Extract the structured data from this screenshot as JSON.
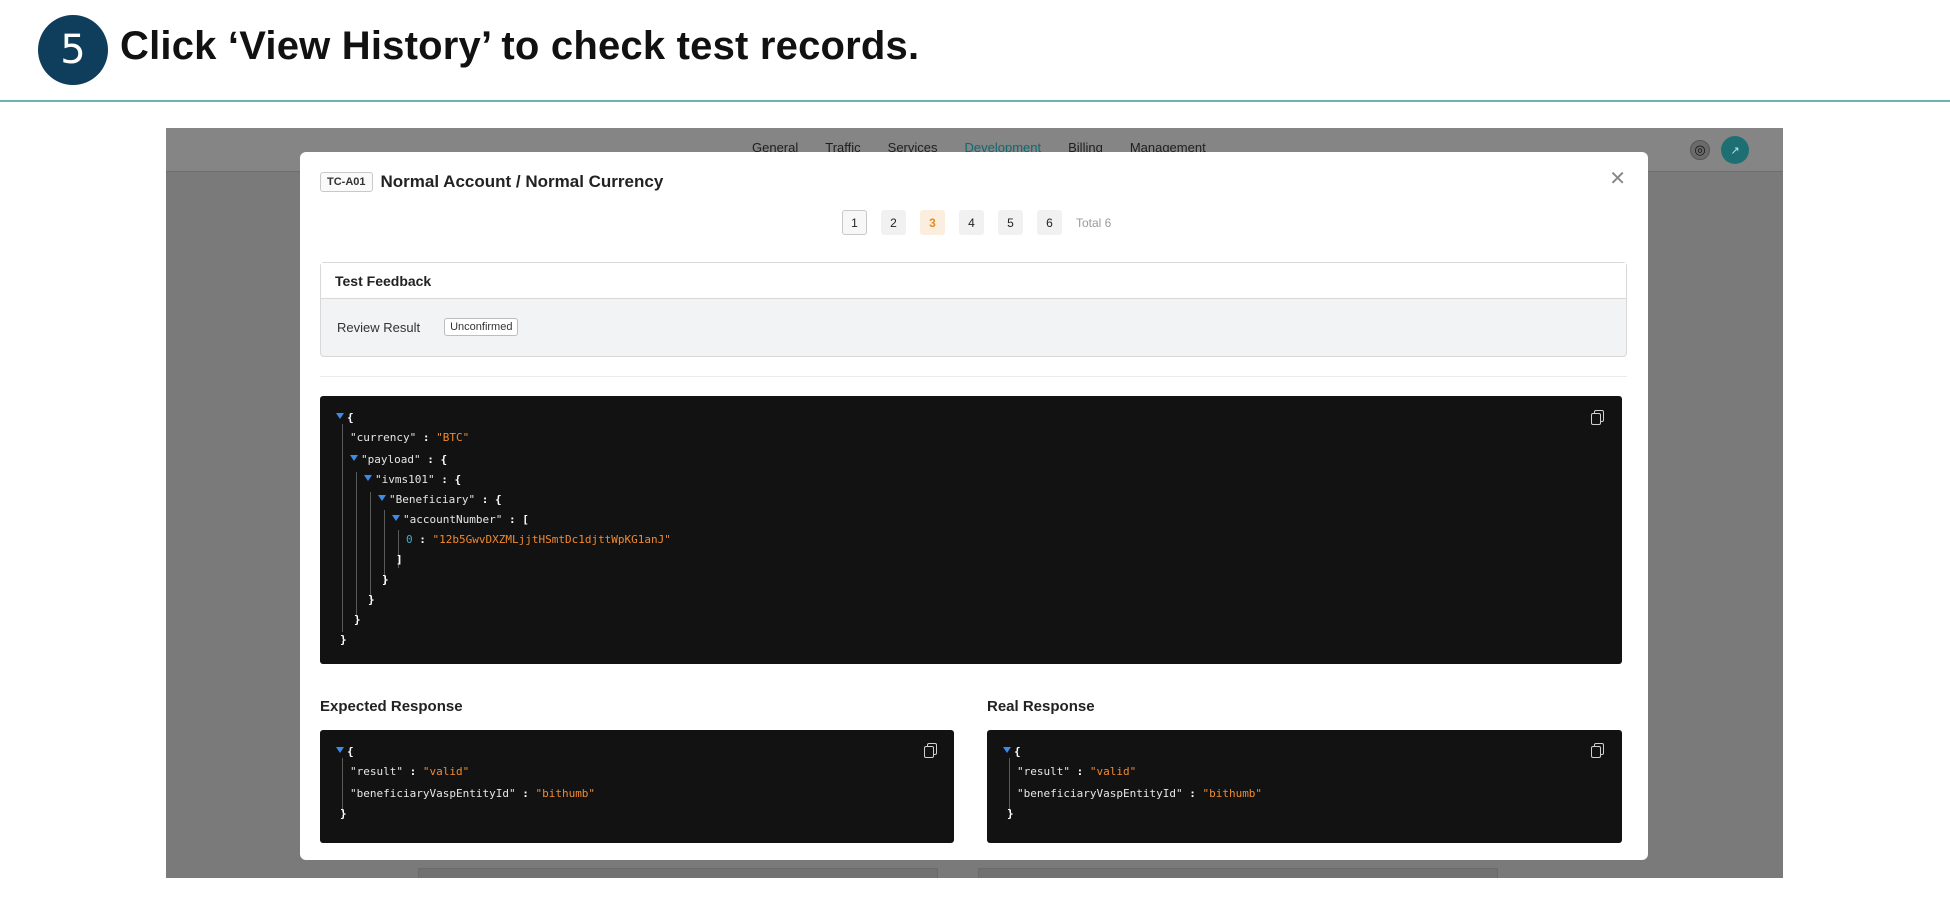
{
  "step": {
    "number": "5",
    "title": "Click ‘View History’ to check test records."
  },
  "topbar": {
    "nav": [
      "General",
      "Traffic",
      "Services",
      "Development",
      "Billing",
      "Management"
    ],
    "active_index": 3,
    "globe_icon": "globe-icon",
    "avatar_text": "↗"
  },
  "modal": {
    "tag": "TC-A01",
    "title": "Normal Account / Normal Currency",
    "close_glyph": "✕",
    "pagination": {
      "pages": [
        "1",
        "2",
        "3",
        "4",
        "5",
        "6"
      ],
      "current": "3",
      "total": "Total 6"
    },
    "feedback": {
      "header": "Test Feedback",
      "label": "Review Result",
      "value": "Unconfirmed"
    },
    "request": {
      "open": "{",
      "currency_key": "\"currency\"",
      "currency_val": "\"BTC\"",
      "payload_key": "\"payload\"",
      "ivms_key": "\"ivms101\"",
      "beneficiary_key": "\"Beneficiary\"",
      "account_key": "\"accountNumber\"",
      "bracket_open": "[",
      "index": "0",
      "account_val": "\"12b5GwvDXZMLjjtHSmtDc1djttWpKG1anJ\"",
      "bracket_close": "]",
      "close": "}",
      "colon": " : "
    },
    "expected": {
      "label": "Expected Response",
      "result_key": "\"result\"",
      "result_val": "\"valid\"",
      "entity_key": "\"beneficiaryVaspEntityId\"",
      "entity_val": "\"bithumb\""
    },
    "real": {
      "label": "Real Response",
      "result_key": "\"result\"",
      "result_val": "\"valid\"",
      "entity_key": "\"beneficiaryVaspEntityId\"",
      "entity_val": "\"bithumb\""
    }
  },
  "colors": {
    "accent": "#0e3e5c",
    "rule": "#6cb3b5",
    "string": "#f08a30",
    "current_page": "#e58a1f"
  }
}
